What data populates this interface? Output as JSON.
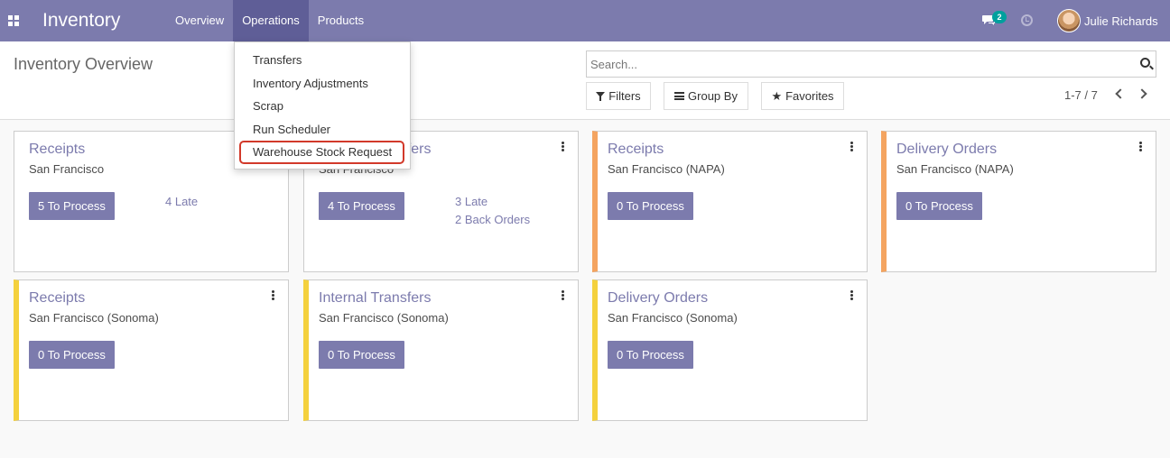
{
  "navbar": {
    "brand": "Inventory",
    "menu": [
      {
        "label": "Overview"
      },
      {
        "label": "Operations",
        "active": true
      },
      {
        "label": "Products"
      }
    ],
    "chat_badge": "2",
    "user_name": "Julie Richards"
  },
  "operations_menu": {
    "items": [
      "Transfers",
      "Inventory Adjustments",
      "Scrap",
      "Run Scheduler",
      "Warehouse Stock Request"
    ],
    "highlighted": "Warehouse Stock Request"
  },
  "control_panel": {
    "title": "Inventory Overview",
    "search_placeholder": "Search...",
    "filters_label": "Filters",
    "groupby_label": "Group By",
    "favorites_label": "Favorites",
    "pager": "1-7 / 7"
  },
  "cards": [
    {
      "title": "Receipts",
      "subtitle": "San Francisco",
      "button": "5 To Process",
      "links": [
        "4 Late"
      ],
      "color": "none"
    },
    {
      "title": "Internal Transfers",
      "subtitle": "San Francisco",
      "button": "4 To Process",
      "links": [
        "3 Late",
        "2 Back Orders"
      ],
      "color": "none"
    },
    {
      "title": "Receipts",
      "subtitle": "San Francisco (NAPA)",
      "button": "0 To Process",
      "links": [],
      "color": "#f4a460"
    },
    {
      "title": "Delivery Orders",
      "subtitle": "San Francisco (NAPA)",
      "button": "0 To Process",
      "links": [],
      "color": "#f4a460"
    },
    {
      "title": "Receipts",
      "subtitle": "San Francisco (Sonoma)",
      "button": "0 To Process",
      "links": [],
      "color": "#f4d13d"
    },
    {
      "title": "Internal Transfers",
      "subtitle": "San Francisco (Sonoma)",
      "button": "0 To Process",
      "links": [],
      "color": "#f4d13d"
    },
    {
      "title": "Delivery Orders",
      "subtitle": "San Francisco (Sonoma)",
      "button": "0 To Process",
      "links": [],
      "color": "#f4d13d"
    }
  ],
  "colors": {
    "navbar": "#7c7bad",
    "active_menu": "#5f5e97",
    "primary": "#7c7bad",
    "highlight_border": "#d2392a"
  }
}
